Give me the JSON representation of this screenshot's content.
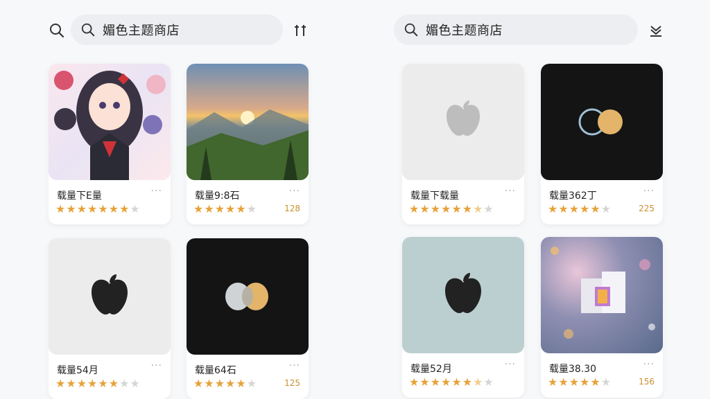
{
  "search": {
    "query": "媚色主题商店"
  },
  "left": {
    "sort_icon": "sort-icon",
    "cards": [
      {
        "title": "载量下E量",
        "rating": 7,
        "max": 8,
        "count": "",
        "thumb": "anime-collage"
      },
      {
        "title": "载量9:8石",
        "rating": 5,
        "max": 6,
        "count": "128",
        "thumb": "mountain-sunrise"
      },
      {
        "title": "载量54月",
        "rating": 6,
        "max": 8,
        "count": "",
        "thumb": "apple-logo-light"
      },
      {
        "title": "载量64石",
        "rating": 5,
        "max": 6,
        "count": "125",
        "thumb": "infinity-logo-dark"
      }
    ]
  },
  "right": {
    "sort_icon": "download-icon",
    "cards": [
      {
        "title": "载量下载量",
        "rating": 6.5,
        "max": 8,
        "count": "",
        "thumb": "apple-logo-grey"
      },
      {
        "title": "载量362丁",
        "rating": 5,
        "max": 6,
        "count": "225",
        "thumb": "infinity-logo-dark"
      },
      {
        "title": "载量52月",
        "rating": 6.5,
        "max": 8,
        "count": "",
        "thumb": "apple-logo-teal"
      },
      {
        "title": "载量38.30",
        "rating": 5,
        "max": 6,
        "count": "156",
        "thumb": "bokeh-box"
      }
    ]
  },
  "colors": {
    "star": "#e6a33a",
    "star_off": "#d6d6d6",
    "count": "#c98f2e",
    "search_bg": "#eceef1"
  },
  "icons": {
    "search": "search-icon",
    "more": "more-icon"
  },
  "labels": {
    "more": "···"
  }
}
